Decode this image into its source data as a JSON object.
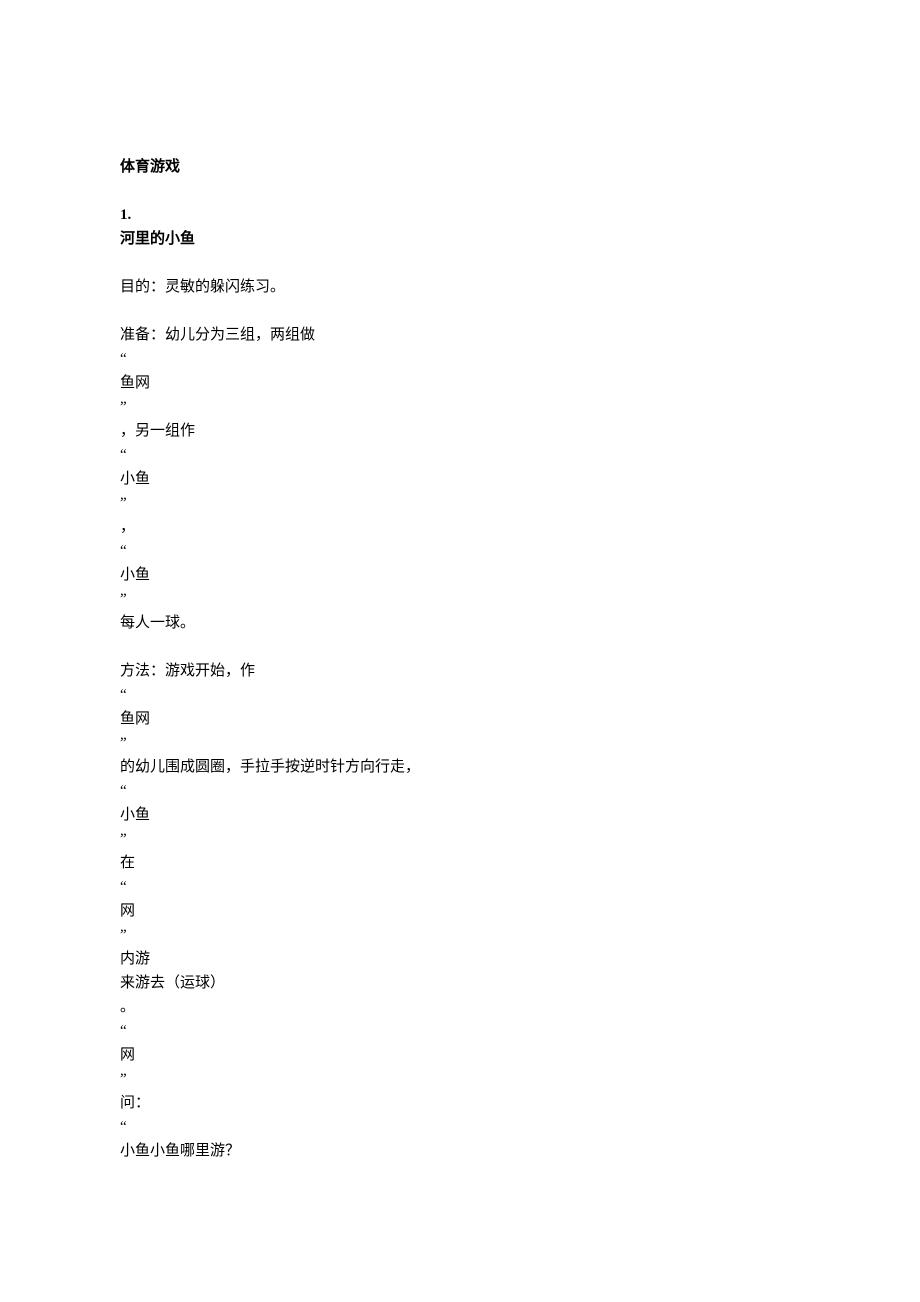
{
  "title": "体育游戏",
  "item_number": "1.",
  "item_title": "河里的小鱼",
  "purpose": "目的：灵敏的躲闪练习。",
  "prep_lines": [
    "准备：幼儿分为三组，两组做",
    "“",
    "鱼网",
    "”",
    "，另一组作",
    "“",
    "小鱼",
    "”",
    "，",
    "“",
    "小鱼",
    "”",
    "每人一球。"
  ],
  "method_lines": [
    "方法：游戏开始，作",
    "“",
    "鱼网",
    "”",
    "的幼儿围成圆圈，手拉手按逆时针方向行走，",
    "“",
    "小鱼",
    "”",
    "在",
    "“",
    "网",
    "”",
    "内游",
    "来游去（运球）",
    "。",
    "“",
    "网",
    "”",
    "问：",
    "“",
    "小鱼小鱼哪里游？"
  ]
}
